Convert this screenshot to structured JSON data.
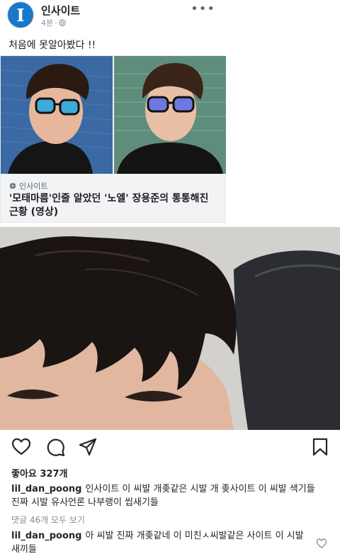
{
  "facebook": {
    "page_name": "인사이트",
    "avatar_letter": "I",
    "time": "4분",
    "post_text": "처음에 못알아봤다 !!",
    "more": "•••",
    "link": {
      "source": "인사이트",
      "title": "'모태마름'인줄 알았던 '노엘' 장용준의 통통해진 근황 (영상)"
    }
  },
  "instagram": {
    "likes": "좋아요 327개",
    "caption": {
      "username": "lil_dan_poong",
      "text": "인사이트 이 씨발 개좆같은 시발 개 좆사이트 이 씨발 색기들 진짜 시발 유사언론 나부랭이 씹새기들"
    },
    "view_all": "댓글 46개 모두 보기",
    "comment": {
      "username": "lil_dan_poong",
      "text": "아 씨발 진짜 개좆같네 이 미친ㅅ씨발같은 사이트 이 시발새끼들"
    }
  }
}
